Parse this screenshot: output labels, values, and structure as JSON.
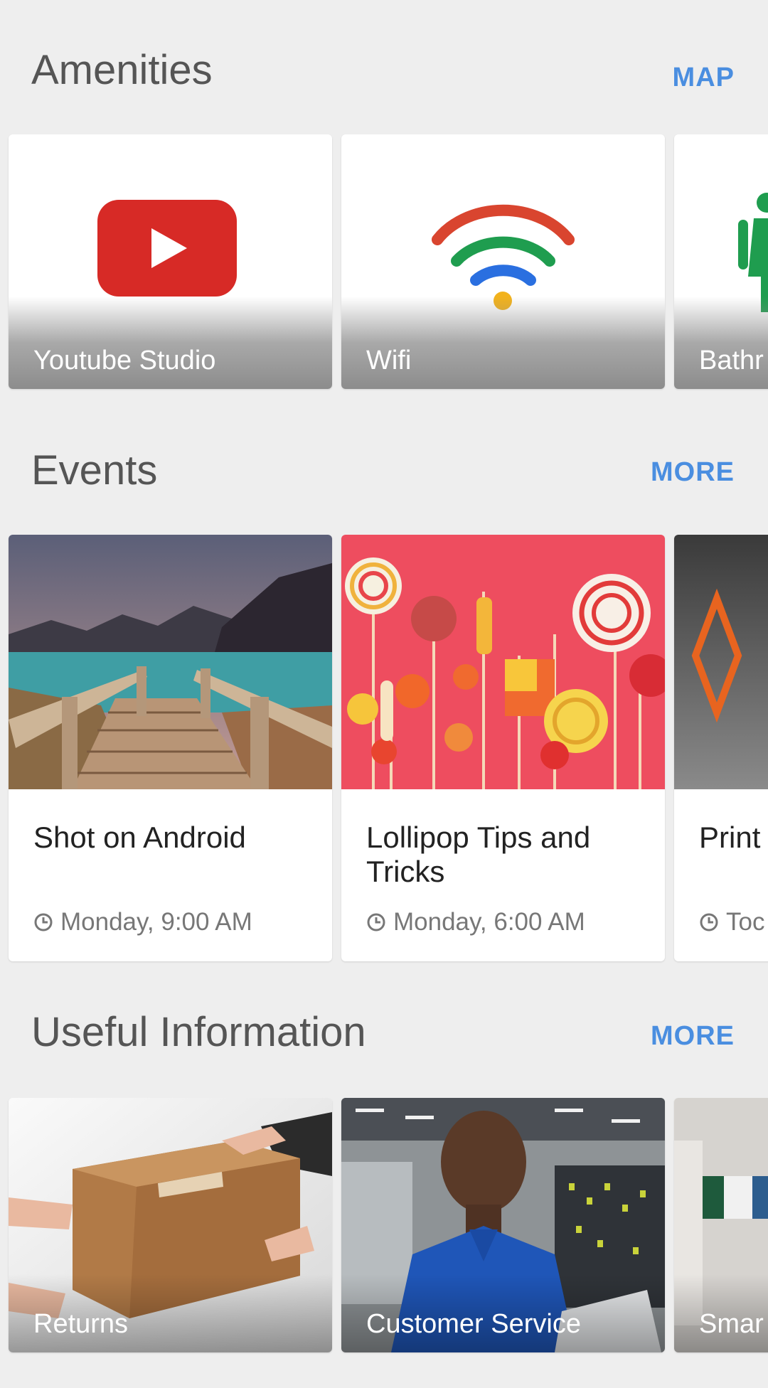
{
  "amenities": {
    "title": "Amenities",
    "action_label": "MAP",
    "items": [
      {
        "label": "Youtube Studio",
        "icon": "youtube-icon"
      },
      {
        "label": "Wifi",
        "icon": "wifi-icon"
      },
      {
        "label": "Bathr",
        "icon": "restroom-icon"
      }
    ]
  },
  "events": {
    "title": "Events",
    "action_label": "MORE",
    "items": [
      {
        "title": "Shot on Android",
        "time": "Monday, 9:00 AM",
        "image": "lake-boardwalk-photo"
      },
      {
        "title": "Lollipop Tips and Tricks",
        "time": "Monday, 6:00 AM",
        "image": "lollipops-photo"
      },
      {
        "title": "Print",
        "time": "Toc",
        "image": "3d-print-photo"
      }
    ]
  },
  "useful_info": {
    "title": "Useful Information",
    "action_label": "MORE",
    "items": [
      {
        "label": "Returns",
        "image": "box-handoff-photo"
      },
      {
        "label": "Customer Service",
        "image": "store-employee-photo"
      },
      {
        "label": "Smar",
        "image": "smart-home-photo"
      }
    ]
  },
  "colors": {
    "background": "#eeeeee",
    "accent": "#4a8ee0",
    "youtube_red": "#d72a26",
    "wifi_red": "#d9452f",
    "wifi_green": "#1f9d4f",
    "wifi_blue": "#2a6fe0",
    "wifi_yellow": "#f2b21c",
    "restroom_green": "#1f9d4f"
  }
}
